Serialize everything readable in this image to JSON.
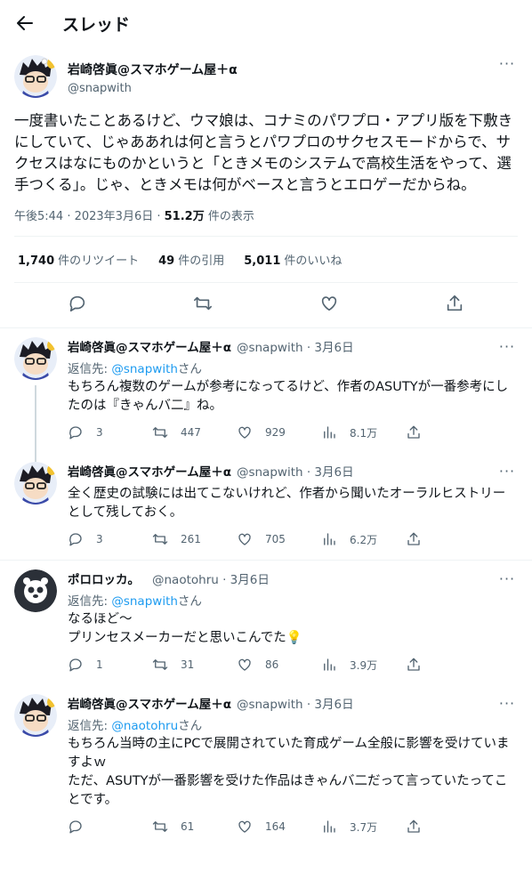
{
  "header": {
    "title": "スレッド"
  },
  "main": {
    "name": "岩崎啓眞@スマホゲーム屋＋α",
    "handle": "@snapwith",
    "text": "一度書いたことあるけど、ウマ娘は、コナミのパワプロ・アプリ版を下敷きにしていて、じゃああれは何と言うとパワプロのサクセスモードからで、サクセスはなにものかというと「ときメモのシステムで高校生活をやって、選手つくる」。じゃ、ときメモは何がベースと言うとエロゲーだからね。",
    "time": "午後5:44 · 2023年3月6日 · ",
    "views": "51.2万",
    "views_label": " 件の表示",
    "retweets": "1,740",
    "retweets_label": "件のリツイート",
    "quotes": "49",
    "quotes_label": "件の引用",
    "likes": "5,011",
    "likes_label": "件のいいね"
  },
  "replies": [
    {
      "name": "岩崎啓眞@スマホゲーム屋＋α",
      "handle": "@snapwith · 3月6日",
      "replyto_prefix": "返信先: ",
      "replyto_link": "@snapwith",
      "replyto_suffix": "さん",
      "text": "もちろん複数のゲームが参考になってるけど、作者のASUTYが一番参考にしたのは『きゃんバ二』ね。",
      "replies": "3",
      "retweets": "447",
      "likes": "929",
      "views": "8.1万"
    },
    {
      "name": "岩崎啓眞@スマホゲーム屋＋α",
      "handle": "@snapwith · 3月6日",
      "text": "全く歴史の試験には出てこないけれど、作者から聞いたオーラルヒストリーとして残しておく。",
      "replies": "3",
      "retweets": "261",
      "likes": "705",
      "views": "6.2万"
    },
    {
      "name": "ポロロッカ。",
      "handle": "@naotohru · 3月6日",
      "replyto_prefix": "返信先: ",
      "replyto_link": "@snapwith",
      "replyto_suffix": "さん",
      "text": "なるほど～\nプリンセスメーカーだと思いこんでた💡",
      "replies": "1",
      "retweets": "31",
      "likes": "86",
      "views": "3.9万"
    },
    {
      "name": "岩崎啓眞@スマホゲーム屋＋α",
      "handle": "@snapwith · 3月6日",
      "replyto_prefix": "返信先: ",
      "replyto_link": "@naotohru",
      "replyto_suffix": "さん",
      "text": "もちろん当時の主にPCで展開されていた育成ゲーム全般に影響を受けていますよｗ\nただ、ASUTYが一番影響を受けた作品はきゃんバ二だって言っていたってことです。",
      "replies": "",
      "retweets": "61",
      "likes": "164",
      "views": "3.7万"
    }
  ]
}
